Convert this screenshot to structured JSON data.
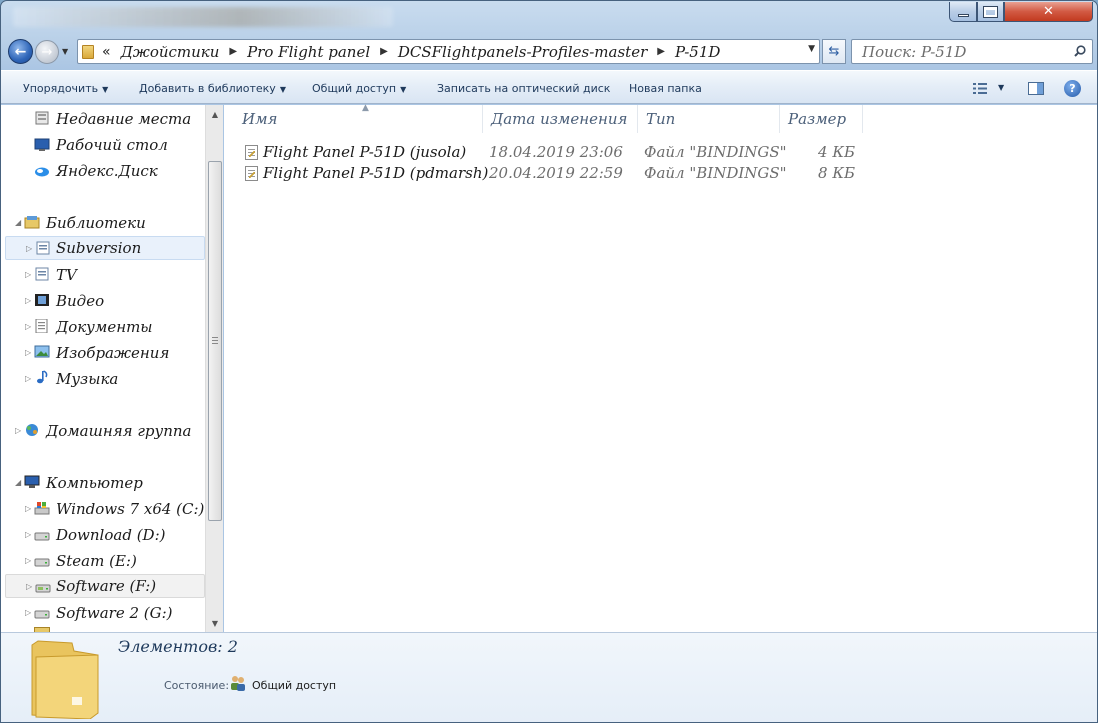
{
  "address": {
    "overflow_chevron": "«",
    "crumbs": [
      "Джойстики",
      "Pro Flight panel",
      "DCSFlightpanels-Profiles-master",
      "P-51D"
    ]
  },
  "search": {
    "placeholder": "Поиск: P-51D"
  },
  "toolbar": {
    "organize": "Упорядочить",
    "add_library": "Добавить в библиотеку",
    "share": "Общий доступ",
    "burn": "Записать на оптический диск",
    "new_folder": "Новая папка"
  },
  "nav": {
    "items": [
      {
        "label": "Недавние места",
        "icon": "recent-places-icon"
      },
      {
        "label": "Рабочий стол",
        "icon": "desktop-icon"
      },
      {
        "label": "Яндекс.Диск",
        "icon": "yandex-disk-icon"
      },
      {
        "label": "Библиотеки",
        "icon": "libraries-icon"
      },
      {
        "label": "Subversion",
        "icon": "library-icon"
      },
      {
        "label": "TV",
        "icon": "library-icon"
      },
      {
        "label": "Видео",
        "icon": "video-icon"
      },
      {
        "label": "Документы",
        "icon": "documents-icon"
      },
      {
        "label": "Изображения",
        "icon": "pictures-icon"
      },
      {
        "label": "Музыка",
        "icon": "music-icon"
      },
      {
        "label": "Домашняя группа",
        "icon": "homegroup-icon"
      },
      {
        "label": "Компьютер",
        "icon": "computer-icon"
      },
      {
        "label": "Windows 7 x64 (C:)",
        "icon": "system-drive-icon"
      },
      {
        "label": "Download (D:)",
        "icon": "drive-icon"
      },
      {
        "label": "Steam (E:)",
        "icon": "drive-icon"
      },
      {
        "label": "Software (F:)",
        "icon": "drive-icon"
      },
      {
        "label": "Software 2 (G:)",
        "icon": "drive-icon"
      }
    ]
  },
  "columns": {
    "name": "Имя",
    "date": "Дата изменения",
    "type": "Тип",
    "size": "Размер"
  },
  "files": [
    {
      "name": "Flight Panel P-51D (jusola)",
      "date": "18.04.2019 23:06",
      "type": "Файл \"BINDINGS\"",
      "size": "4 КБ"
    },
    {
      "name": "Flight Panel P-51D (pdmarsh)",
      "date": "20.04.2019 22:59",
      "type": "Файл \"BINDINGS\"",
      "size": "8 КБ"
    }
  ],
  "details": {
    "count": "Элементов: 2",
    "state_label": "Состояние:",
    "state_value": "Общий доступ"
  },
  "colors": {
    "accent": "#1e395b",
    "selection": "#e9f1fb"
  }
}
